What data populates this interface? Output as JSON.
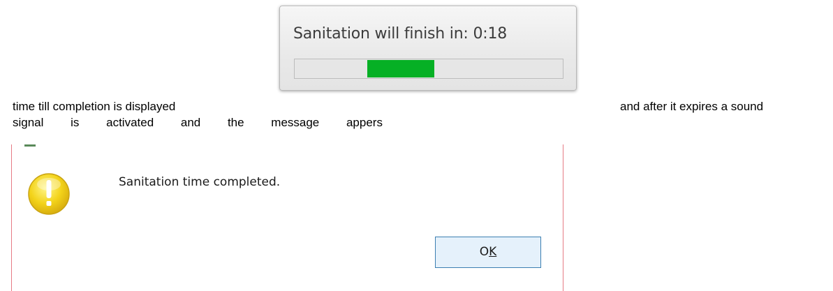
{
  "document": {
    "line1_before": "time till completion is displayed",
    "line1_after": "and after it expires a sound",
    "line2_words": [
      "signal",
      "is",
      "activated",
      "and",
      "the",
      "message",
      "appers"
    ]
  },
  "progress_popup": {
    "text": "Sanitation will finish in: 0:18",
    "indicator_start_fraction": 0.27,
    "indicator_end_fraction": 0.52,
    "indicator_color": "#06b025",
    "track_color": "#e6e6e6"
  },
  "message_dialog": {
    "message": "Sanitation time completed.",
    "icon": "warning-exclamation-icon",
    "icon_color": "#f3d31a",
    "border_color": "#e67b84",
    "ok_button": {
      "label_prefix": "O",
      "label_mnemonic": "K"
    }
  }
}
